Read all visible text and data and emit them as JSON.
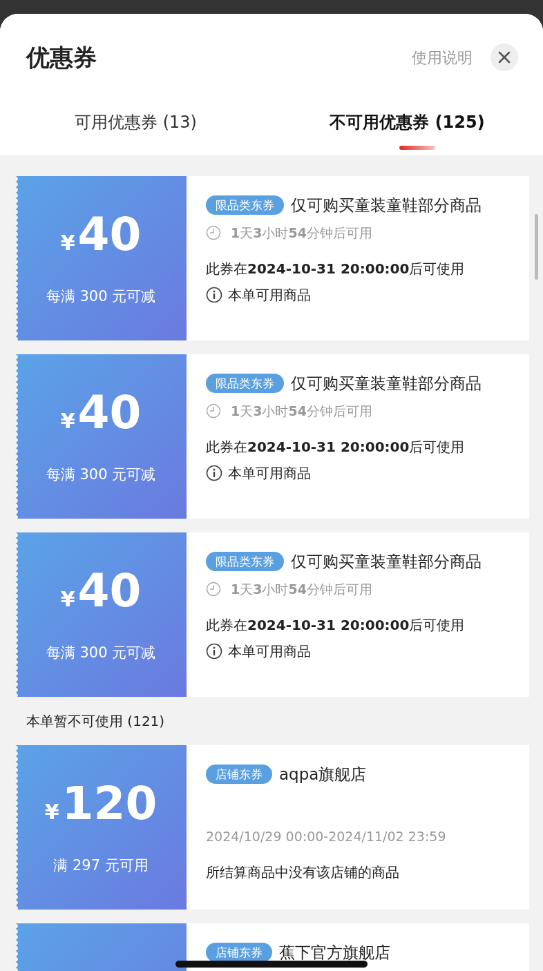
{
  "sheet": {
    "title": "优惠券",
    "help_link": "使用说明"
  },
  "tabs": [
    {
      "label": "可用优惠券 (13)",
      "selected": false
    },
    {
      "label": "不可用优惠券 (125)",
      "selected": true
    }
  ],
  "sections": [
    {
      "coupons": [
        {
          "kind": "pending",
          "currency": "¥",
          "amount": "40",
          "condition": "每满 300 元可减",
          "tag": "限品类东券",
          "title": "仅可购买童装童鞋部分商品",
          "countdown": "**1**天**3**小时**54**分钟后可用",
          "notice": "此券在**2024-10-31 20:00:00**后可使用",
          "info": "本单可用商品"
        },
        {
          "kind": "pending",
          "currency": "¥",
          "amount": "40",
          "condition": "每满 300 元可减",
          "tag": "限品类东券",
          "title": "仅可购买童装童鞋部分商品",
          "countdown": "**1**天**3**小时**54**分钟后可用",
          "notice": "此券在**2024-10-31 20:00:00**后可使用",
          "info": "本单可用商品"
        },
        {
          "kind": "pending",
          "currency": "¥",
          "amount": "40",
          "condition": "每满 300 元可减",
          "tag": "限品类东券",
          "title": "仅可购买童装童鞋部分商品",
          "countdown": "**1**天**3**小时**54**分钟后可用",
          "notice": "此券在**2024-10-31 20:00:00**后可使用",
          "info": "本单可用商品"
        }
      ]
    },
    {
      "heading": "本单暂不可使用 (121)",
      "coupons": [
        {
          "kind": "store",
          "currency": "¥",
          "amount": "120",
          "condition": "满 297 元可用",
          "tag": "店铺东券",
          "title": "aqpa旗舰店",
          "validity": "2024/10/29 00:00-2024/11/02 23:59",
          "reason": "所结算商品中没有该店铺的商品"
        },
        {
          "kind": "store",
          "tag": "店铺东券",
          "title": "蕉下官方旗舰店"
        }
      ]
    }
  ]
}
